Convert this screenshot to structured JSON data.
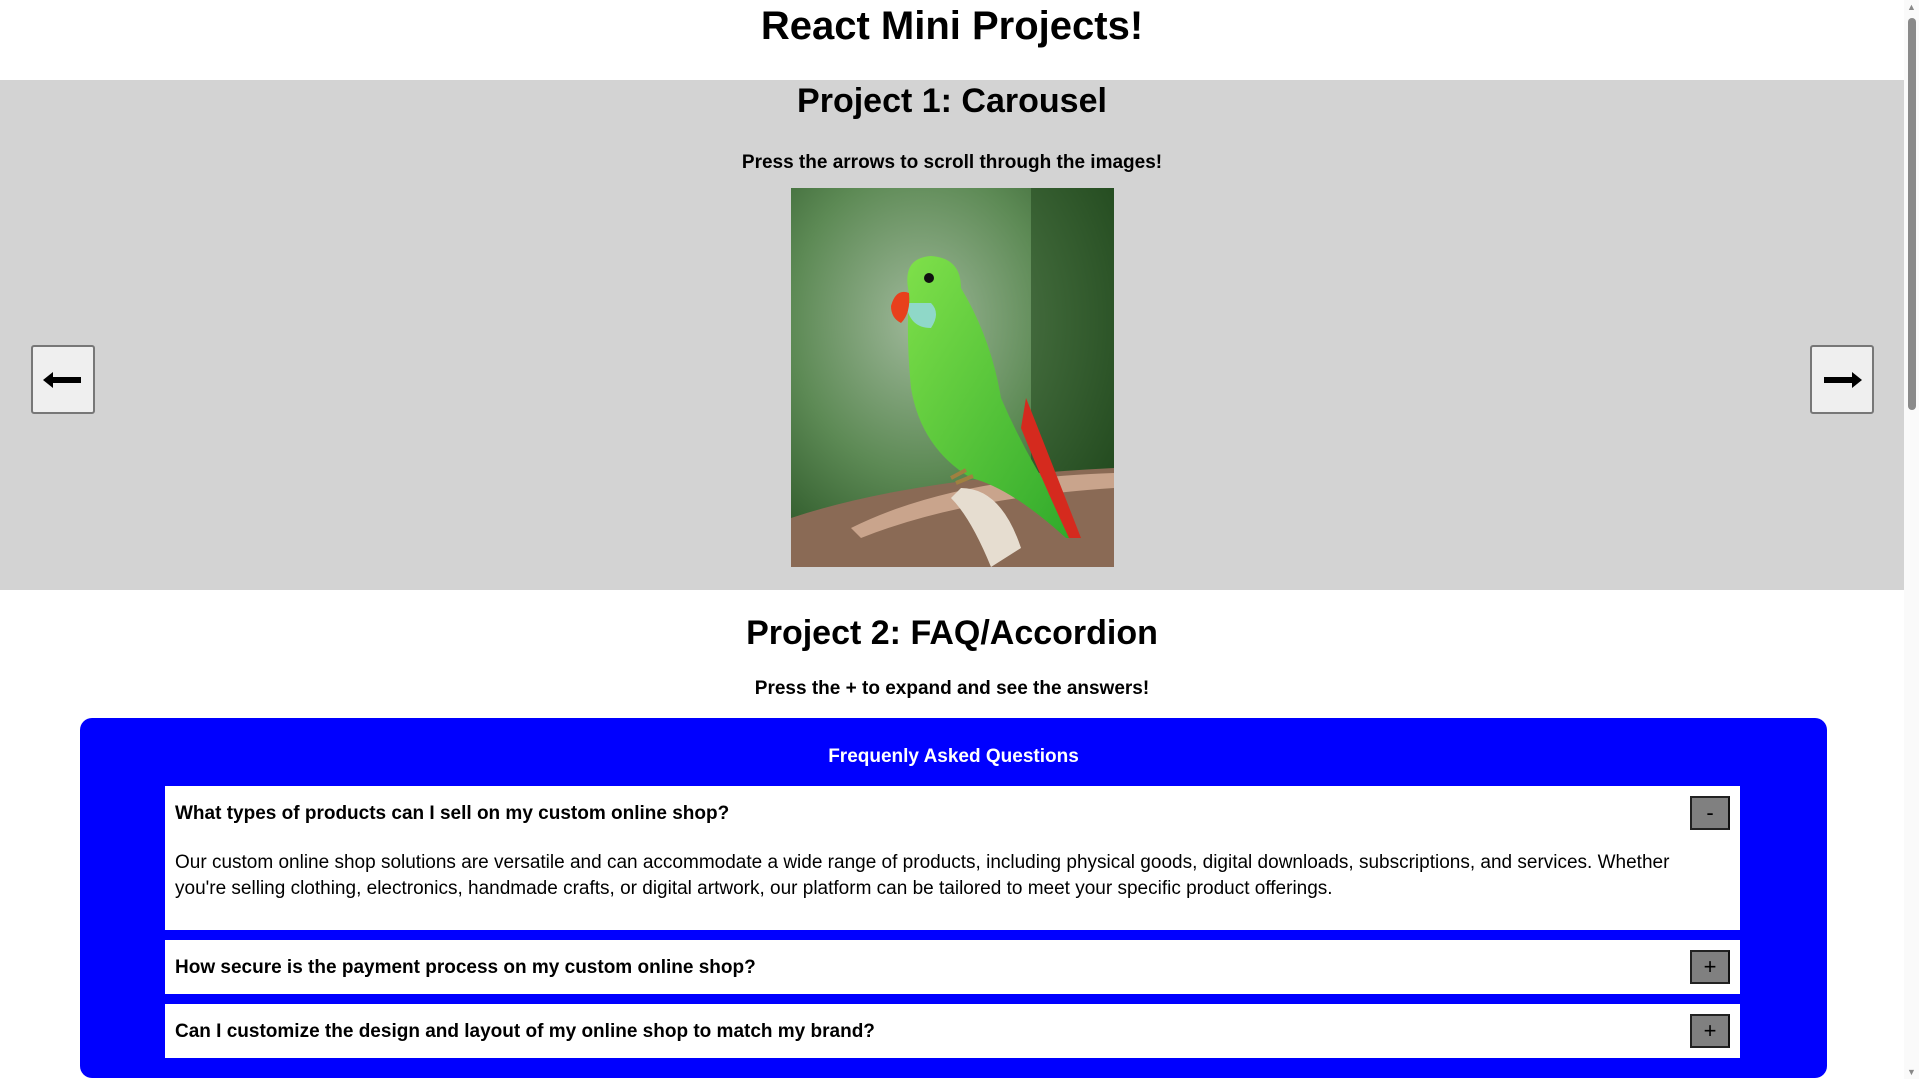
{
  "title": "React Mini Projects!",
  "carousel": {
    "heading": "Project 1: Carousel",
    "instructions": "Press the arrows to scroll through the images!",
    "prev_icon": "arrow-left-icon",
    "next_icon": "arrow-right-icon"
  },
  "faq": {
    "heading": "Project 2: FAQ/Accordion",
    "instructions": "Press the + to expand and see the answers!",
    "box_title": "Frequenly Asked Questions",
    "items": [
      {
        "question": "What types of products can I sell on my custom online shop?",
        "toggle": "-",
        "answer": "Our custom online shop solutions are versatile and can accommodate a wide range of products, including physical goods, digital downloads, subscriptions, and services. Whether you're selling clothing, electronics, handmade crafts, or digital artwork, our platform can be tailored to meet your specific product offerings."
      },
      {
        "question": "How secure is the payment process on my custom online shop?",
        "toggle": "+"
      },
      {
        "question": "Can I customize the design and layout of my online shop to match my brand?",
        "toggle": "+"
      }
    ]
  },
  "colors": {
    "faq_bg": "#0000ff",
    "carousel_bg": "#d3d3d3"
  }
}
